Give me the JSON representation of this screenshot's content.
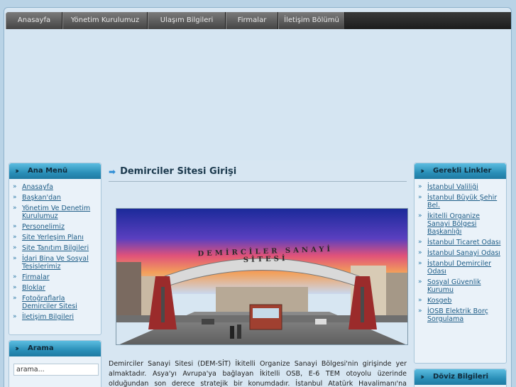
{
  "nav": {
    "items": [
      "Anasayfa",
      "Yönetim Kurulumuz",
      "Ulaşım Bilgileri",
      "Firmalar",
      "İletişim Bölümü"
    ]
  },
  "left_menu": {
    "title": "Ana Menü",
    "items": [
      "Anasayfa",
      "Başkan'dan",
      "Yönetim Ve Denetim Kurulumuz",
      "Personelimiz",
      "Site Yerleşim Planı",
      "Site Tanıtım Bilgileri",
      "İdari Bina Ve Sosyal Tesislerimiz",
      "Firmalar",
      "Bloklar",
      "Fotoğraflarla Demirciler Sitesi",
      "İletişim Bilgileri"
    ]
  },
  "search": {
    "title": "Arama",
    "value": "arama..."
  },
  "right_links": {
    "title": "Gerekli Linkler",
    "items": [
      "İstanbul Valiliği",
      "İstanbul Büyük Şehir Bel.",
      "İkitelli Organize Sanayi Bölgesi Başkanlığı",
      "İstanbul Ticaret Odası",
      "İstanbul Sanayi Odası",
      "İstanbul Demirciler Odası",
      "Sosyal Güvenlik Kurumu",
      "Kosgeb",
      "İOSB Elektrik Borç Sorgulama"
    ]
  },
  "currency": {
    "title": "Döviz Bilgileri"
  },
  "main": {
    "title": "Demirciler Sitesi Girişi",
    "photo_sign": "DEMİRCİLER SANAYİ SİTESİ",
    "paragraph": "Demirciler Sanayi Sitesi (DEM-SİT) İkitelli Organize Sanayi Bölgesi'nin girişinde yer almaktadır. Asya'yı Avrupa'ya bağlayan İkitelli OSB, E-6 TEM otoyolu üzerinde olduğundan son derece stratejik bir konumdadır. İstanbul Atatürk Havalimanı'na yakınlığı da bölgeye ayrı bir avantaj"
  },
  "colors": {
    "page_bg": "#b9d3e6",
    "nav_bg": "#2b2b2b",
    "box_head": "#2a8fb8",
    "link": "#1d5c86"
  }
}
